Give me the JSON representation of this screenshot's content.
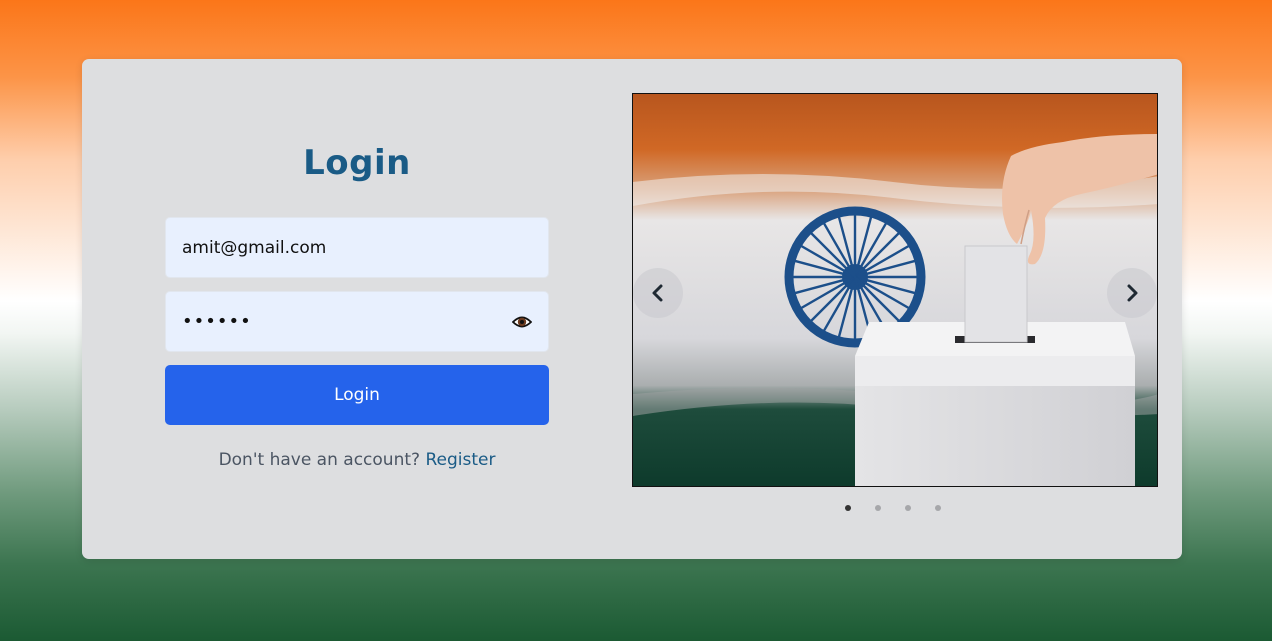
{
  "login": {
    "title": "Login",
    "email_value": "amit@gmail.com",
    "password_value": "amit12",
    "button_label": "Login",
    "register_prompt": "Don't have an account?",
    "register_link": "Register"
  },
  "carousel": {
    "prev_icon": "chevron-left-icon",
    "next_icon": "chevron-right-icon",
    "slide_count": 4,
    "active_slide": 1
  },
  "colors": {
    "title": "#1a5b86",
    "button": "#2563eb",
    "field_bg": "#e8f0fe",
    "card_bg": "#dddee0",
    "saffron": "#fb7619",
    "green": "#1b5a33"
  }
}
